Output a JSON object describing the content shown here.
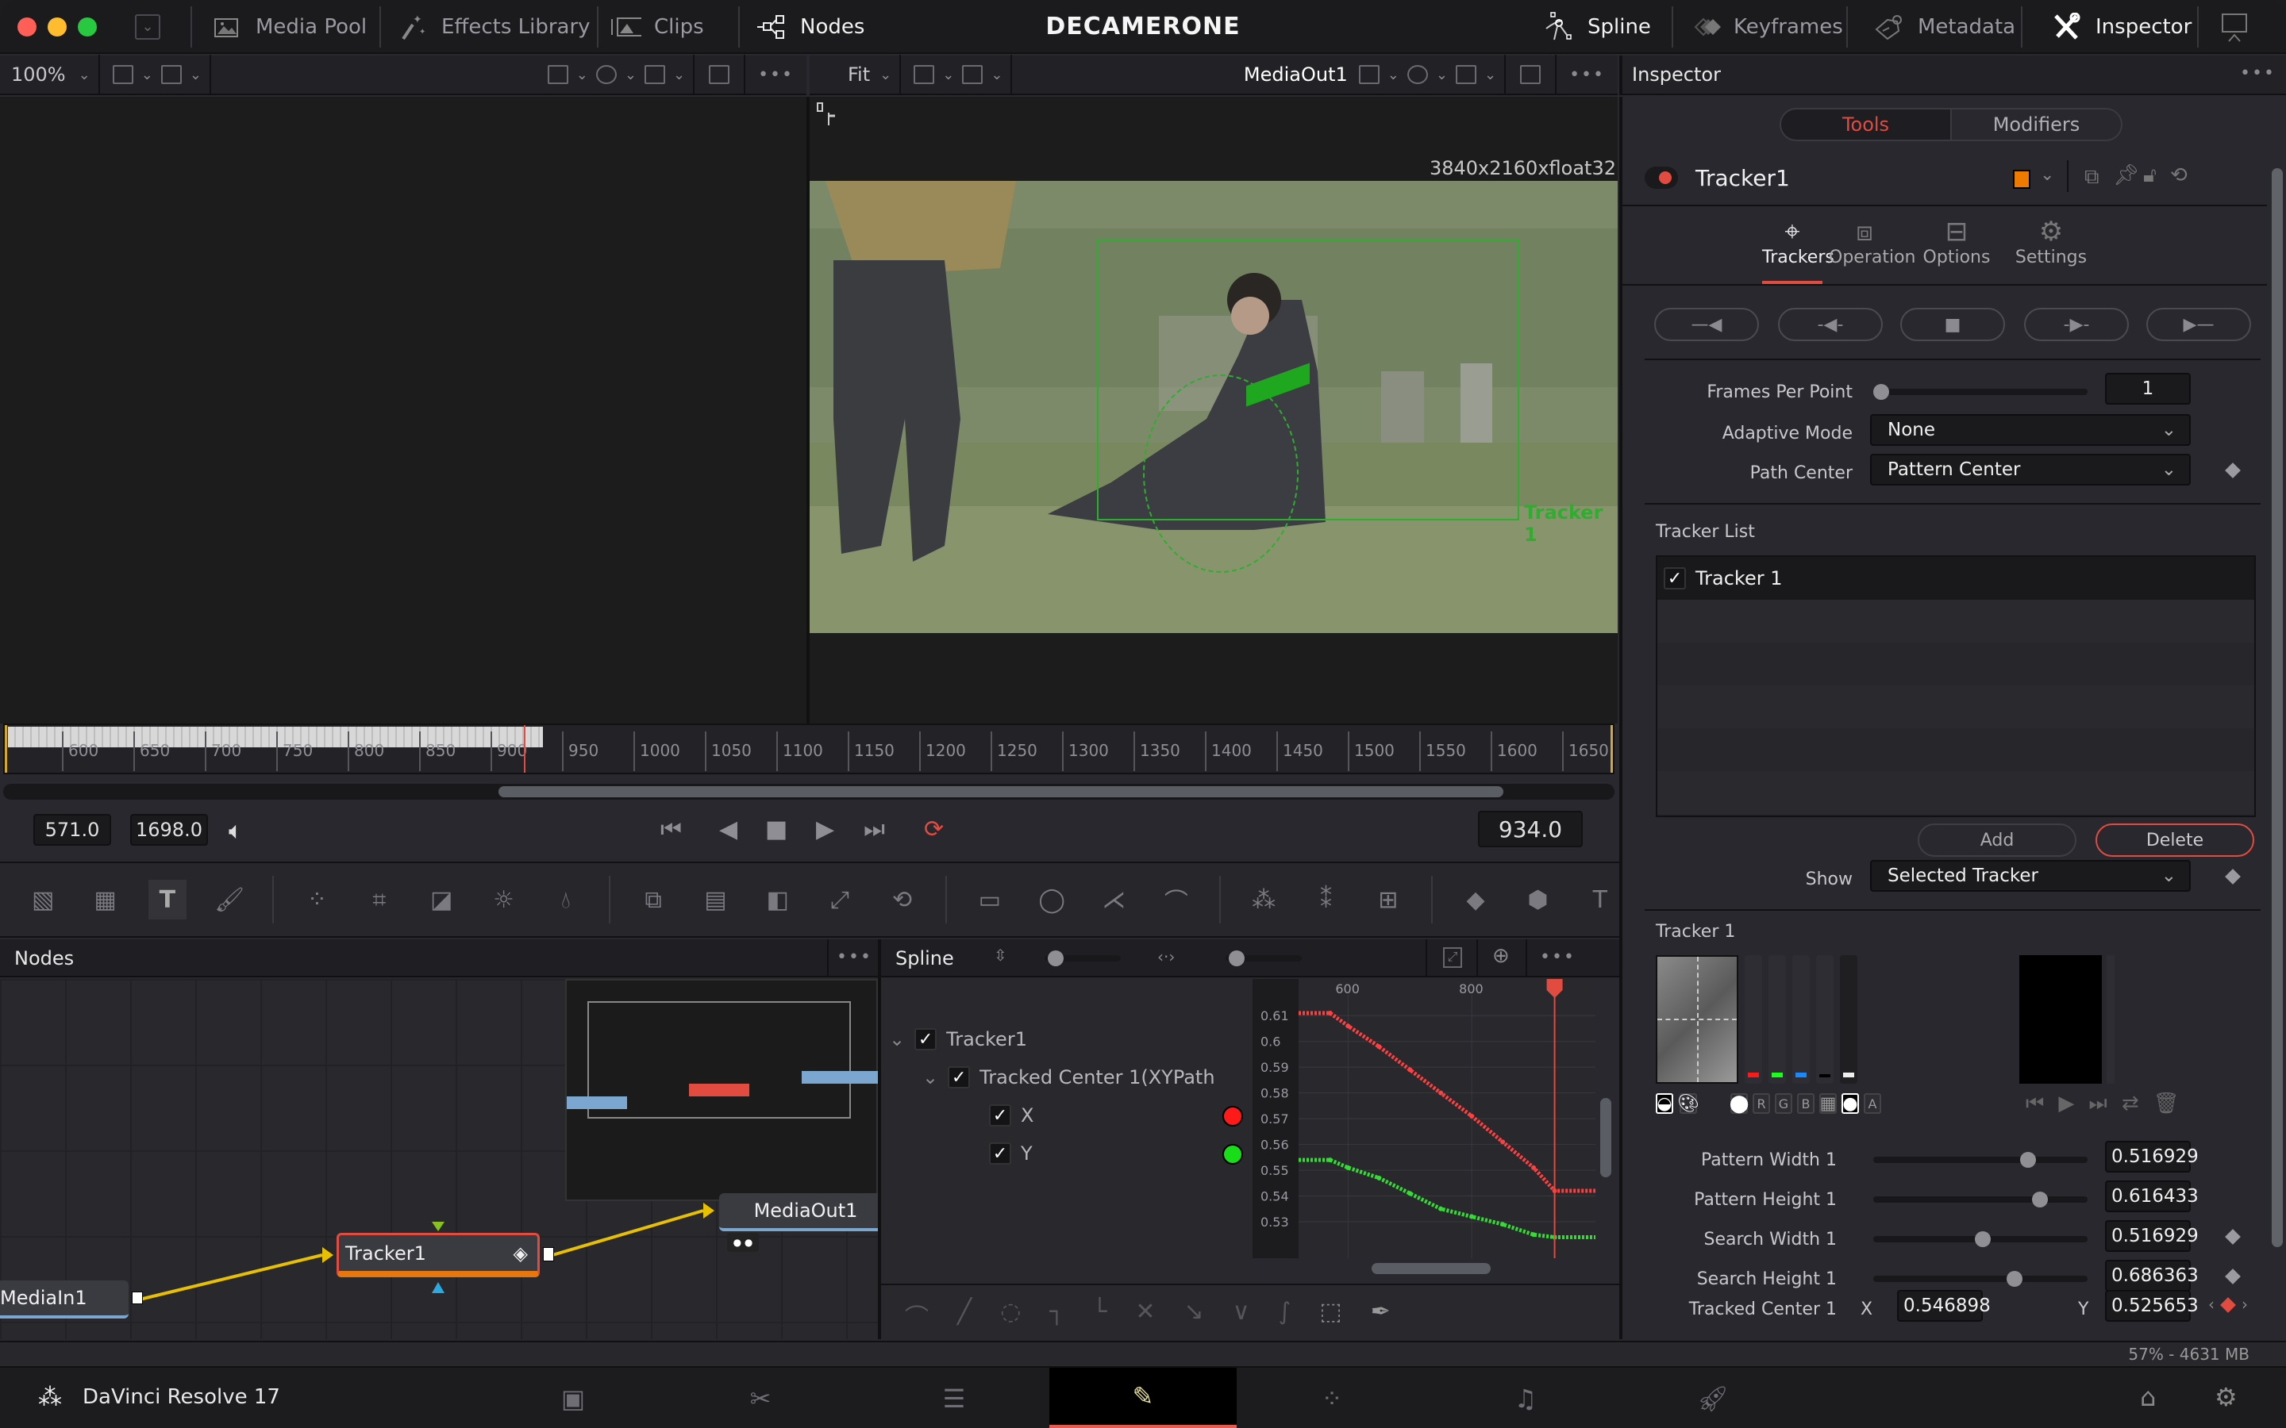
{
  "window": {
    "title": "DECAMERONE",
    "traffic_lights": {
      "close": "#ff5f57",
      "minimize": "#febc2e",
      "maximize": "#28c840"
    }
  },
  "top_nav": {
    "left": [
      {
        "label": "Media Pool",
        "icon": "media-pool-icon",
        "active": false
      },
      {
        "label": "Effects Library",
        "icon": "effects-library-icon",
        "active": false
      },
      {
        "label": "Clips",
        "icon": "clips-icon",
        "active": false
      },
      {
        "label": "Nodes",
        "icon": "nodes-icon",
        "active": true
      }
    ],
    "right": [
      {
        "label": "Spline",
        "icon": "spline-icon",
        "active": true
      },
      {
        "label": "Keyframes",
        "icon": "keyframes-icon",
        "active": false
      },
      {
        "label": "Metadata",
        "icon": "metadata-icon",
        "active": false
      },
      {
        "label": "Inspector",
        "icon": "inspector-icon",
        "active": true
      }
    ]
  },
  "viewer_left": {
    "zoom": "100%"
  },
  "viewer_right": {
    "zoom": "Fit",
    "source": "MediaOut1",
    "resolution": "3840x2160xfloat32",
    "tracker_label": "Tracker 1"
  },
  "timeline": {
    "ticks": [
      "600",
      "650",
      "700",
      "750",
      "800",
      "850",
      "900",
      "950",
      "1000",
      "1050",
      "1100",
      "1150",
      "1200",
      "1250",
      "1300",
      "1350",
      "1400",
      "1450",
      "1500",
      "1550",
      "1600",
      "1650"
    ],
    "start": "571.0",
    "end": "1698.0",
    "current": "934.0"
  },
  "nodes_panel": {
    "title": "Nodes",
    "nodes": [
      {
        "label": "MediaIn1"
      },
      {
        "label": "Tracker1"
      },
      {
        "label": "MediaOut1"
      }
    ]
  },
  "spline_panel": {
    "title": "Spline",
    "tree": [
      {
        "label": "Tracker1",
        "checked": true
      },
      {
        "label": "Tracked Center 1(XYPath",
        "checked": true
      },
      {
        "label": "X",
        "checked": true,
        "color": "#ff2a2a"
      },
      {
        "label": "Y",
        "checked": true,
        "color": "#22e022"
      }
    ]
  },
  "chart_data": {
    "type": "line",
    "title": "Spline",
    "xlabel": "",
    "ylabel": "",
    "x_ticks": [
      "600",
      "800"
    ],
    "y_ticks": [
      "0.61",
      "0.6",
      "0.59",
      "0.58",
      "0.57",
      "0.56",
      "0.55",
      "0.54",
      "0.53"
    ],
    "xlim": [
      520,
      1000
    ],
    "ylim": [
      0.522,
      0.615
    ],
    "current_frame": 934,
    "series": [
      {
        "name": "X",
        "color": "#ff4040",
        "x": [
          520,
          571,
          600,
          650,
          700,
          750,
          800,
          850,
          900,
          934,
          1000
        ],
        "y": [
          0.611,
          0.611,
          0.606,
          0.598,
          0.589,
          0.58,
          0.571,
          0.561,
          0.551,
          0.542,
          0.542
        ]
      },
      {
        "name": "Y",
        "color": "#33dd33",
        "x": [
          520,
          571,
          600,
          650,
          700,
          750,
          800,
          850,
          900,
          934,
          1000
        ],
        "y": [
          0.554,
          0.554,
          0.551,
          0.547,
          0.541,
          0.535,
          0.532,
          0.529,
          0.525,
          0.524,
          0.524
        ]
      }
    ]
  },
  "inspector": {
    "header": "Inspector",
    "tabs": [
      {
        "label": "Tools",
        "active": true
      },
      {
        "label": "Modifiers",
        "active": false
      }
    ],
    "tool_name": "Tracker1",
    "tool_color": "#ef7a00",
    "subtabs": [
      {
        "label": "Trackers",
        "active": true
      },
      {
        "label": "Operation",
        "active": false
      },
      {
        "label": "Options",
        "active": false
      },
      {
        "label": "Settings",
        "active": false
      }
    ],
    "frames_per_point": {
      "label": "Frames Per Point",
      "value": "1"
    },
    "adaptive_mode": {
      "label": "Adaptive Mode",
      "value": "None"
    },
    "path_center": {
      "label": "Path Center",
      "value": "Pattern Center"
    },
    "tracker_list_label": "Tracker List",
    "tracker_list": [
      {
        "label": "Tracker 1",
        "checked": true
      }
    ],
    "add_label": "Add",
    "delete_label": "Delete",
    "show": {
      "label": "Show",
      "value": "Selected Tracker"
    },
    "tracker_section": "Tracker 1",
    "channel_buttons": [
      "R",
      "G",
      "B",
      "A"
    ],
    "params": [
      {
        "label": "Pattern Width 1",
        "value": "0.516929",
        "fraction": 0.74
      },
      {
        "label": "Pattern Height 1",
        "value": "0.616433",
        "fraction": 0.8
      },
      {
        "label": "Search Width 1",
        "value": "0.516929",
        "fraction": 0.51
      },
      {
        "label": "Search Height 1",
        "value": "0.686363",
        "fraction": 0.67
      }
    ],
    "tracked_center": {
      "label": "Tracked Center 1",
      "x_label": "X",
      "x": "0.546898",
      "y_label": "Y",
      "y": "0.525653"
    }
  },
  "status": {
    "memory": "57% - 4631 MB"
  },
  "footer": {
    "app_name": "DaVinci Resolve 17",
    "pages": [
      "media",
      "cut",
      "edit",
      "fusion",
      "color",
      "fairlight",
      "deliver"
    ],
    "active_page": "fusion",
    "accent": "#e65a4f"
  }
}
